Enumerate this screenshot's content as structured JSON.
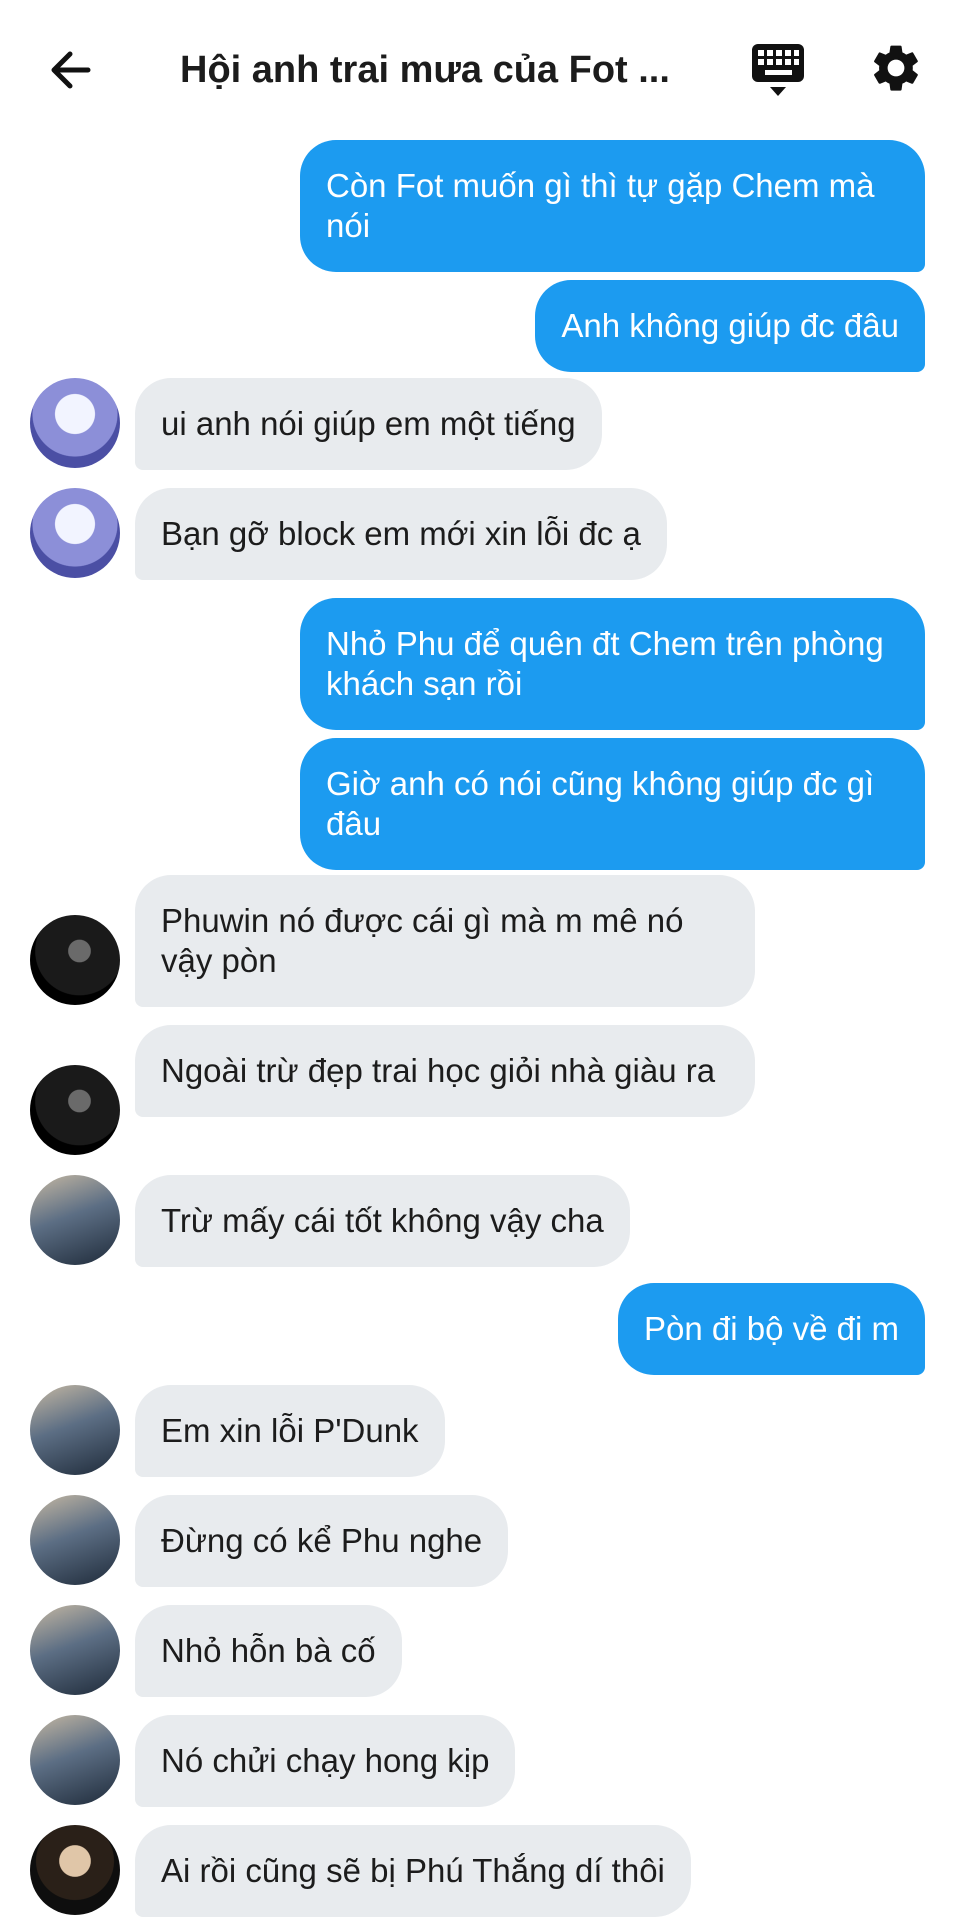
{
  "header": {
    "title": "Hội anh trai mưa của Fot ...",
    "back_icon": "arrow-left-icon",
    "keyboard_icon": "keyboard-icon",
    "settings_icon": "gear-icon"
  },
  "colors": {
    "outgoing_bubble": "#1c9bf0",
    "incoming_bubble": "#e8ebee"
  },
  "messages": [
    {
      "dir": "out",
      "text": "Còn Fot muốn gì thì tự gặp Chem mà nói"
    },
    {
      "dir": "out",
      "text": "Anh không giúp đc đâu"
    },
    {
      "dir": "in",
      "text": "ui anh nói giúp em một tiếng"
    },
    {
      "dir": "in",
      "text": "Bạn gỡ block em mới xin lỗi đc ạ"
    },
    {
      "dir": "out",
      "text": "Nhỏ Phu để quên đt Chem trên phòng khách sạn rồi"
    },
    {
      "dir": "out",
      "text": "Giờ anh có nói cũng không giúp đc gì đâu"
    },
    {
      "dir": "in",
      "text": "Phuwin nó được cái gì mà m mê nó vậy pòn"
    },
    {
      "dir": "in",
      "text": "Ngoài trừ đẹp trai học giỏi nhà giàu ra"
    },
    {
      "dir": "in",
      "text": "Trừ mấy cái tốt không vậy cha"
    },
    {
      "dir": "out",
      "text": "Pòn đi bộ về đi m"
    },
    {
      "dir": "in",
      "text": "Em xin lỗi P'Dunk"
    },
    {
      "dir": "in",
      "text": "Đừng có kể Phu nghe"
    },
    {
      "dir": "in",
      "text": "Nhỏ hỗn bà cố"
    },
    {
      "dir": "in",
      "text": "Nó chửi chạy hong kịp"
    },
    {
      "dir": "in",
      "text": "Ai rồi cũng sẽ bị Phú Thắng dí thôi"
    }
  ]
}
